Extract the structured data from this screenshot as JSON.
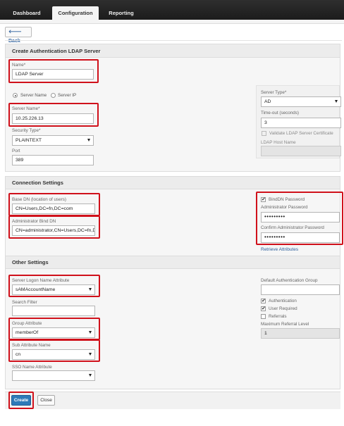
{
  "nav": {
    "tabs": [
      {
        "label": "Dashboard",
        "active": false
      },
      {
        "label": "Configuration",
        "active": true
      },
      {
        "label": "Reporting",
        "active": false
      }
    ]
  },
  "back_label": "Back",
  "page_title": "Create Authentication LDAP Server",
  "name": {
    "label": "Name*",
    "value": "LDAP Server"
  },
  "server_mode": {
    "options": [
      "Server Name",
      "Server IP"
    ],
    "selected": "Server Name"
  },
  "server_name": {
    "label": "Server Name*",
    "value": "10.25.226.13"
  },
  "security_type": {
    "label": "Security Type*",
    "value": "PLAINTEXT"
  },
  "port": {
    "label": "Port",
    "value": "389"
  },
  "server_type": {
    "label": "Server Type*",
    "value": "AD"
  },
  "timeout": {
    "label": "Time-out (seconds)",
    "value": "3"
  },
  "validate_cert": {
    "label": "Validate LDAP Server Certificate",
    "checked": false
  },
  "ldap_host_name": {
    "label": "LDAP Host Name",
    "value": ""
  },
  "connection": {
    "title": "Connection Settings",
    "base_dn": {
      "label": "Base DN (location of users)",
      "value": "CN=Users,DC=fn,DC=com"
    },
    "bind_dn": {
      "label": "Administrator Bind DN",
      "value": "CN=administrator,CN=Users,DC=fn,D"
    },
    "binddn_password": {
      "label": "BindDN Password",
      "checked": true
    },
    "admin_password": {
      "label": "Administrator Password",
      "value": "•••••••••"
    },
    "confirm_password": {
      "label": "Confirm Administrator Password",
      "value": "•••••••••"
    },
    "retrieve_attributes": "Retrieve Attributes"
  },
  "other": {
    "title": "Other Settings",
    "logon_attr": {
      "label": "Server Logon Name Attribute",
      "value": "sAMAccountName"
    },
    "search_filter": {
      "label": "Search Filter",
      "value": ""
    },
    "group_attr": {
      "label": "Group Attribute",
      "value": "memberOf"
    },
    "sub_attr": {
      "label": "Sub Attribute Name",
      "value": "cn"
    },
    "sso_attr": {
      "label": "SSO Name Attribute",
      "value": ""
    },
    "default_group": {
      "label": "Default Authentication Group",
      "value": ""
    },
    "authentication": {
      "label": "Authentication",
      "checked": true
    },
    "user_required": {
      "label": "User Required",
      "checked": true
    },
    "referrals": {
      "label": "Referrals",
      "checked": false
    },
    "max_referral": {
      "label": "Maximum Referral Level",
      "value": "1"
    }
  },
  "buttons": {
    "create": "Create",
    "close": "Close"
  },
  "highlight_color": "#d0111b"
}
